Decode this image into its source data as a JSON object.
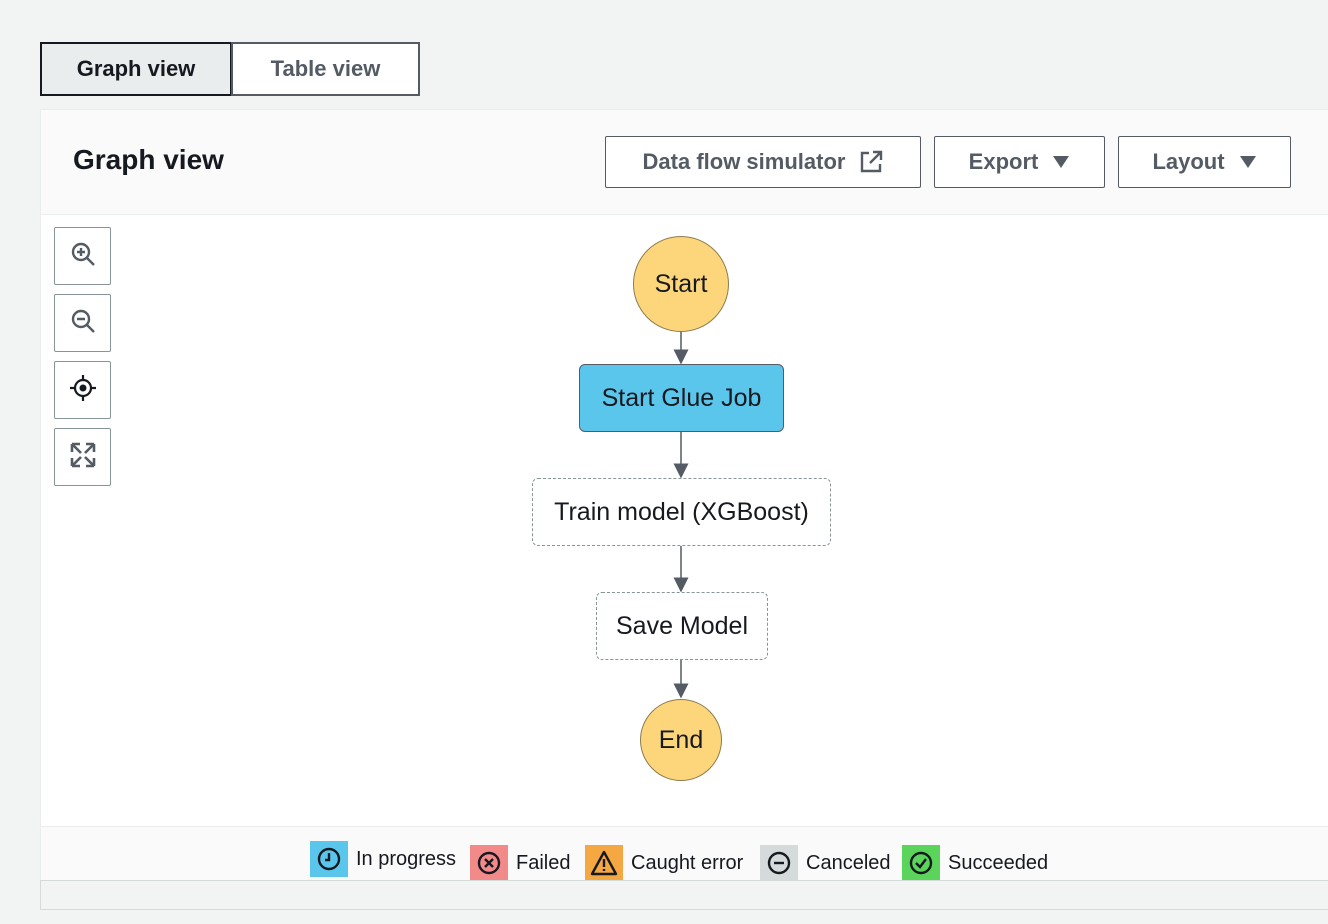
{
  "tabs": [
    {
      "label": "Graph view",
      "active": true
    },
    {
      "label": "Table view",
      "active": false
    }
  ],
  "panel": {
    "title": "Graph view",
    "buttons": {
      "simulator": "Data flow simulator",
      "export": "Export",
      "layout": "Layout"
    }
  },
  "zoom_controls": [
    {
      "icon": "zoom-in-icon"
    },
    {
      "icon": "zoom-out-icon"
    },
    {
      "icon": "center-icon"
    },
    {
      "icon": "fit-screen-icon"
    }
  ],
  "graph": {
    "nodes": [
      {
        "label": "Start",
        "kind": "circle"
      },
      {
        "label": "Start Glue Job",
        "kind": "task",
        "color": "#5bc6eb"
      },
      {
        "label": "Train model (XGBoost)",
        "kind": "dashed"
      },
      {
        "label": "Save Model",
        "kind": "dashed"
      },
      {
        "label": "End",
        "kind": "circle"
      }
    ],
    "circle_color": "#fdd67b"
  },
  "legend": [
    {
      "label": "In progress",
      "icon": "clock-icon",
      "color": "#5bc6eb"
    },
    {
      "label": "Failed",
      "icon": "x-circle-icon",
      "color": "#f28a8a"
    },
    {
      "label": "Caught error",
      "icon": "warning-icon",
      "color": "#f5a742"
    },
    {
      "label": "Canceled",
      "icon": "minus-circle-icon",
      "color": "#d5dbdb"
    },
    {
      "label": "Succeeded",
      "icon": "check-circle-icon",
      "color": "#5ad45a"
    }
  ]
}
